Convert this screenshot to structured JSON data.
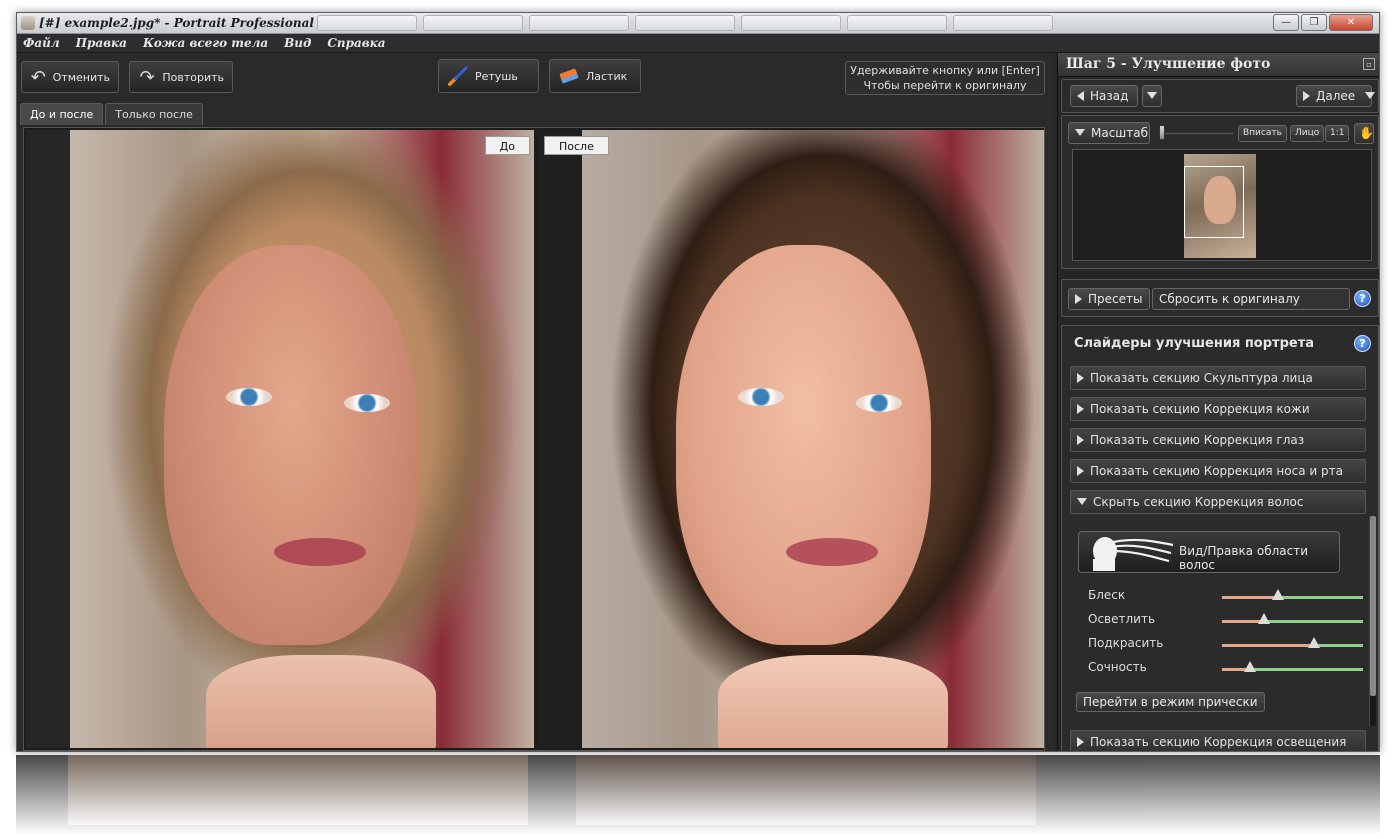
{
  "window": {
    "title": "[#] example2.jpg* - Portrait Professional [#]",
    "controls": {
      "minimize": "—",
      "restore": "❐",
      "close": "✕"
    }
  },
  "menu": [
    "Файл",
    "Правка",
    "Кожа всего тела",
    "Вид",
    "Справка"
  ],
  "toolbar": {
    "undo_label": "Отменить",
    "redo_label": "Повторить",
    "retouch_label": "Ретушь",
    "eraser_label": "Ластик",
    "hint_line1": "Удерживайте кнопку или [Enter]",
    "hint_line2": "Чтобы перейти к оригиналу"
  },
  "view_tabs": [
    "До и после",
    "Только после"
  ],
  "viewer": {
    "before_label": "До",
    "after_label": "После"
  },
  "panel": {
    "step_title": "Шаг 5 - Улучшение фото",
    "back_label": "Назад",
    "next_label": "Далее",
    "zoom_label": "Масштаб",
    "fit_label": "Вписать",
    "face_label": "Лицо",
    "one_to_one_label": "1:1",
    "zoom_level": 0.03,
    "presets_label": "Пресеты",
    "preset_value": "Сбросить к оригиналу",
    "sliders_title": "Слайдеры улучшения портрета",
    "help_glyph": "?",
    "sections": [
      "Показать секцию Скульптура лица",
      "Показать секцию Коррекция кожи",
      "Показать секцию Коррекция глаз",
      "Показать секцию Коррекция носа и рта",
      "Скрыть секцию Коррекция волос",
      "Показать секцию Коррекция освещения кожи"
    ],
    "hair_area_label": "Вид/Правка области волос",
    "hair_sliders": [
      {
        "label": "Блеск",
        "value": 0.4
      },
      {
        "label": "Осветлить",
        "value": 0.3
      },
      {
        "label": "Подкрасить",
        "value": 0.65
      },
      {
        "label": "Сочность",
        "value": 0.2
      }
    ],
    "hairstyle_mode_label": "Перейти в режим прически"
  },
  "colors": {
    "accent_help": "#1f4fb5",
    "slider_left": "#e3a98a",
    "slider_right": "#8fd28a"
  }
}
